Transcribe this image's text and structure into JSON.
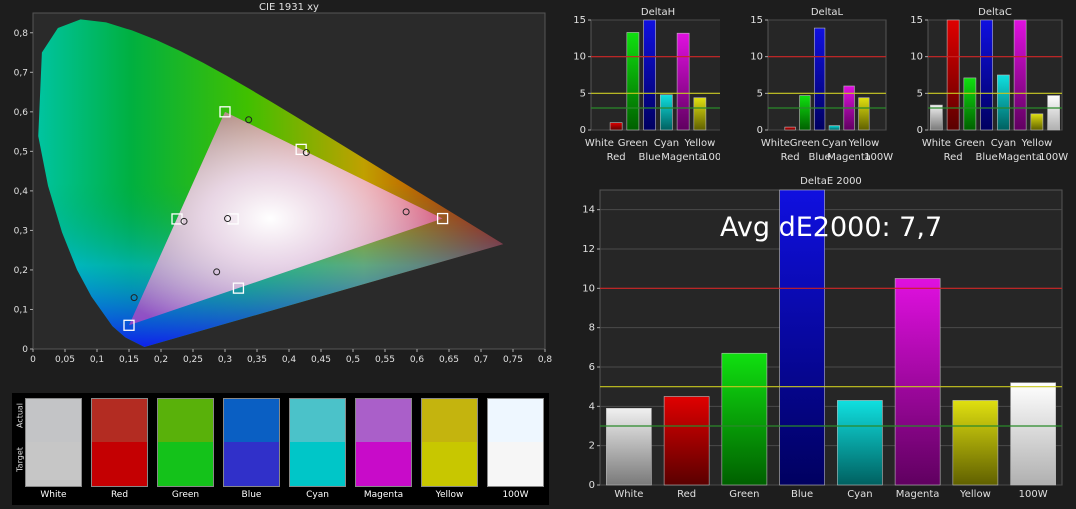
{
  "chart_data": [
    {
      "type": "scatter",
      "title": "CIE 1931 xy",
      "xlim": [
        0,
        0.8
      ],
      "ylim": [
        0,
        0.85
      ],
      "x_ticks": [
        "0",
        "0,05",
        "0,1",
        "0,15",
        "0,2",
        "0,25",
        "0,3",
        "0,35",
        "0,4",
        "0,45",
        "0,5",
        "0,55",
        "0,6",
        "0,65",
        "0,7",
        "0,75",
        "0,8"
      ],
      "y_ticks": [
        "0",
        "0,1",
        "0,2",
        "0,3",
        "0,4",
        "0,5",
        "0,6",
        "0,7",
        "0,8"
      ],
      "targets": [
        {
          "name": "Red",
          "x": 0.64,
          "y": 0.33
        },
        {
          "name": "Green",
          "x": 0.3,
          "y": 0.6
        },
        {
          "name": "Blue",
          "x": 0.15,
          "y": 0.06
        },
        {
          "name": "Cyan",
          "x": 0.225,
          "y": 0.329
        },
        {
          "name": "Magenta",
          "x": 0.321,
          "y": 0.154
        },
        {
          "name": "Yellow",
          "x": 0.419,
          "y": 0.505
        },
        {
          "name": "White",
          "x": 0.3127,
          "y": 0.329
        }
      ],
      "actual": [
        {
          "name": "Red",
          "x": 0.583,
          "y": 0.347
        },
        {
          "name": "Green",
          "x": 0.337,
          "y": 0.58
        },
        {
          "name": "Blue",
          "x": 0.158,
          "y": 0.13
        },
        {
          "name": "Cyan",
          "x": 0.236,
          "y": 0.323
        },
        {
          "name": "Magenta",
          "x": 0.287,
          "y": 0.195
        },
        {
          "name": "Yellow",
          "x": 0.427,
          "y": 0.497
        },
        {
          "name": "White",
          "x": 0.304,
          "y": 0.33
        }
      ]
    },
    {
      "type": "bar",
      "title": "DeltaH",
      "ylim": [
        0,
        15
      ],
      "y_ticks": [
        "0",
        "5",
        "10",
        "15"
      ],
      "categories": [
        "White",
        "Red",
        "Green",
        "Blue",
        "Cyan",
        "Magenta",
        "Yellow",
        "100W"
      ],
      "values": [
        0,
        1.0,
        13.3,
        15,
        4.8,
        13.2,
        4.4,
        0
      ],
      "ref_lines": [
        10,
        5,
        3
      ]
    },
    {
      "type": "bar",
      "title": "DeltaL",
      "ylim": [
        0,
        15
      ],
      "y_ticks": [
        "0",
        "5",
        "10",
        "15"
      ],
      "categories": [
        "White",
        "Red",
        "Green",
        "Blue",
        "Cyan",
        "Magenta",
        "Yellow",
        "100W"
      ],
      "values": [
        0,
        0.4,
        4.7,
        13.9,
        0.6,
        6.0,
        4.4,
        0
      ],
      "ref_lines": [
        10,
        5,
        3
      ]
    },
    {
      "type": "bar",
      "title": "DeltaC",
      "ylim": [
        0,
        15
      ],
      "y_ticks": [
        "0",
        "5",
        "10",
        "15"
      ],
      "categories": [
        "White",
        "Red",
        "Green",
        "Blue",
        "Cyan",
        "Magenta",
        "Yellow",
        "100W"
      ],
      "values": [
        3.4,
        15,
        7.1,
        15,
        7.5,
        15,
        2.2,
        4.7
      ],
      "ref_lines": [
        10,
        5,
        3
      ]
    },
    {
      "type": "bar",
      "title": "DeltaE 2000",
      "ylim": [
        0,
        15
      ],
      "y_ticks": [
        "0",
        "2",
        "4",
        "6",
        "8",
        "10",
        "12",
        "14"
      ],
      "categories": [
        "White",
        "Red",
        "Green",
        "Blue",
        "Cyan",
        "Magenta",
        "Yellow",
        "100W"
      ],
      "values": [
        3.9,
        4.5,
        6.7,
        15,
        4.3,
        10.5,
        4.3,
        5.2
      ],
      "ref_lines": [
        10,
        5,
        3
      ]
    }
  ],
  "avg_label": "Avg dE2000: 7,7",
  "swatches": {
    "actual_label": "Actual",
    "target_label": "Target",
    "items": [
      {
        "name": "White",
        "actual": "#c3c4c6",
        "target": "#c6c6c6"
      },
      {
        "name": "Red",
        "actual": "#b32c22",
        "target": "#c40002"
      },
      {
        "name": "Green",
        "actual": "#59b10a",
        "target": "#14c21a"
      },
      {
        "name": "Blue",
        "actual": "#0a5fc3",
        "target": "#3030c9"
      },
      {
        "name": "Cyan",
        "actual": "#4bc2c9",
        "target": "#00c6c8"
      },
      {
        "name": "Magenta",
        "actual": "#aa5fc9",
        "target": "#c80bc9"
      },
      {
        "name": "Yellow",
        "actual": "#c4b40e",
        "target": "#c8c700"
      },
      {
        "name": "100W",
        "actual": "#eef7ff",
        "target": "#f6f6f6"
      }
    ]
  },
  "bar_colors": {
    "White": [
      "#f0f0f0",
      "#7a7a7a"
    ],
    "Red": [
      "#e00000",
      "#5a0000"
    ],
    "Green": [
      "#10e010",
      "#006000"
    ],
    "Blue": [
      "#1010e0",
      "#000060"
    ],
    "Cyan": [
      "#10e0e0",
      "#006060"
    ],
    "Magenta": [
      "#e010e0",
      "#600060"
    ],
    "Yellow": [
      "#e0e010",
      "#606000"
    ],
    "100W": [
      "#ffffff",
      "#b0b0b0"
    ]
  },
  "ref_line_colors": [
    "#cc2222",
    "#c8c820",
    "#2a8a2a"
  ]
}
